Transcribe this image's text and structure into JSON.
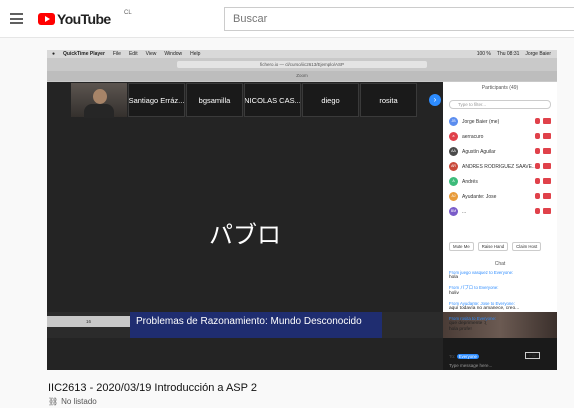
{
  "youtube": {
    "logo_text": "YouTube",
    "country": "CL",
    "search_placeholder": "Buscar"
  },
  "mac": {
    "app": "QuickTime Player",
    "menus": [
      "File",
      "Edit",
      "View",
      "Window",
      "Help"
    ],
    "battery": "100 %",
    "clock": "Thu 08:31",
    "user": "Jorge Baier"
  },
  "browser": {
    "address": "fichero.io — cl/curso/iic2613/Ejemplo/ASP",
    "zoom_title": "Zoom"
  },
  "zoom": {
    "thumbnails": [
      "Santiago Erráz...",
      "bgsamilla",
      "NICOLAS CAS...",
      "diego",
      "rosita"
    ],
    "active_speaker": "パブロ",
    "next_icon": "›",
    "strip_label": "16",
    "slide_title": "Problemas de Razonamiento: Mundo Desconocido"
  },
  "participants": {
    "title": "Participants (49)",
    "filter_placeholder": "Type to filter...",
    "items": [
      {
        "initials": "JB",
        "name": "Jorge Baier (me)",
        "color": "#5b8def"
      },
      {
        "initials": "a",
        "name": "aerracuro",
        "color": "#e0414a"
      },
      {
        "initials": "AA",
        "name": "Agustín Aguilar",
        "color": "#4a4a4a"
      },
      {
        "initials": "AR",
        "name": "ANDRES RODRIGUEZ SAAVE...",
        "color": "#c94a3b"
      },
      {
        "initials": "A",
        "name": "Andrés",
        "color": "#3dbb7a"
      },
      {
        "initials": "AJ",
        "name": "Ayudante: Jose",
        "color": "#e89b3a"
      },
      {
        "initials": "BM",
        "name": "...",
        "color": "#7a5cc9"
      }
    ],
    "buttons": [
      "Mute Me",
      "Raise Hand",
      "Claim Host"
    ]
  },
  "chat": {
    "title": "Chat",
    "messages": [
      {
        "meta": "From juego vasquez to Everyone:",
        "text": "hola"
      },
      {
        "meta": "From パブロ to Everyone:",
        "text": "holiv"
      },
      {
        "meta": "From Ayudante: Jose to Everyone:",
        "text": "aquí todavía no amanece, creo..."
      },
      {
        "meta": "From rosita to Everyone:",
        "text": "que deprimente :(\nhola profe!"
      }
    ],
    "to_label": "To:",
    "to_value": "Everyone",
    "file_label": "File",
    "input_placeholder": "Type message here..."
  },
  "video": {
    "title": "IIC2613 - 2020/03/19 Introducción a ASP 2",
    "visibility": "No listado"
  }
}
